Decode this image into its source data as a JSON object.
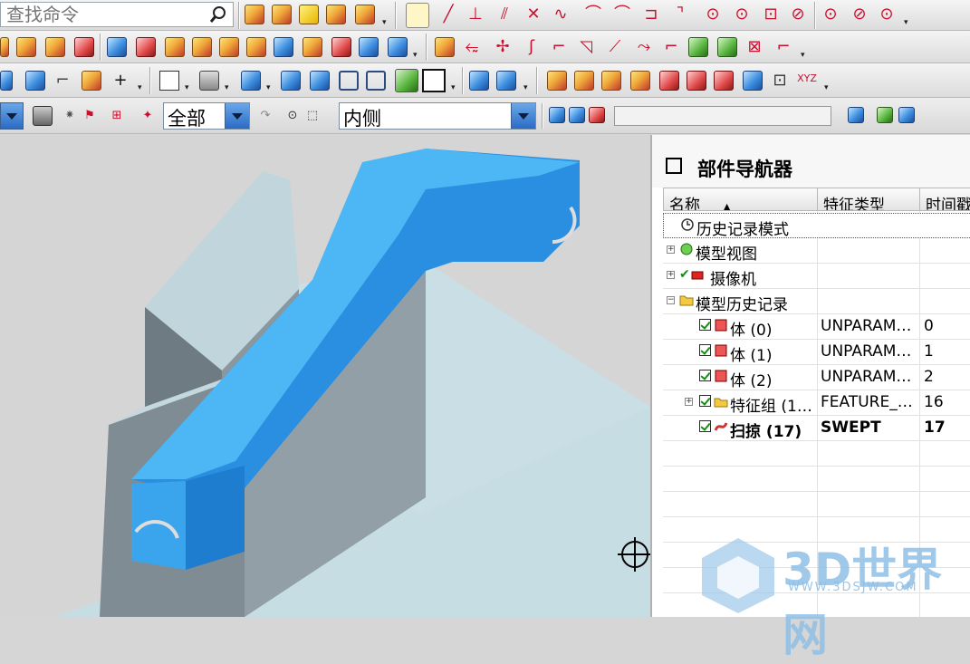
{
  "search": {
    "placeholder": "查找命令"
  },
  "toolbar": {
    "filter_combo_value": "全部",
    "snap_combo_value": "内侧",
    "accent_color": "#2b6bc4"
  },
  "navigator": {
    "title": "部件导航器",
    "columns": [
      "名称",
      "特征类型",
      "时间戳"
    ],
    "rows": [
      {
        "name": "历史记录模式",
        "type": "",
        "stamp": "",
        "icon": "clock-icon",
        "bold": false
      },
      {
        "name": "模型视图",
        "type": "",
        "stamp": "",
        "icon": "model-views-icon",
        "bold": false
      },
      {
        "name": "摄像机",
        "type": "",
        "stamp": "",
        "icon": "camera-icon",
        "bold": false
      },
      {
        "name": "模型历史记录",
        "type": "",
        "stamp": "",
        "icon": "folder-icon",
        "bold": false
      },
      {
        "name": "体 (0)",
        "type": "UNPARAM…",
        "stamp": "0",
        "icon": "body-icon",
        "bold": false
      },
      {
        "name": "体 (1)",
        "type": "UNPARAM…",
        "stamp": "1",
        "icon": "body-icon",
        "bold": false
      },
      {
        "name": "体 (2)",
        "type": "UNPARAM…",
        "stamp": "2",
        "icon": "body-icon",
        "bold": false
      },
      {
        "name": "特征组 (1…",
        "type": "FEATURE_…",
        "stamp": "16",
        "icon": "feature-group-icon",
        "bold": false
      },
      {
        "name": "扫掠 (17)",
        "type": "SWEPT",
        "stamp": "17",
        "icon": "swept-icon",
        "bold": true
      }
    ]
  },
  "watermark": {
    "brand": "3D世界网",
    "url": "WWW.3DSJW.COM"
  },
  "model_color": "#3aa4ec"
}
